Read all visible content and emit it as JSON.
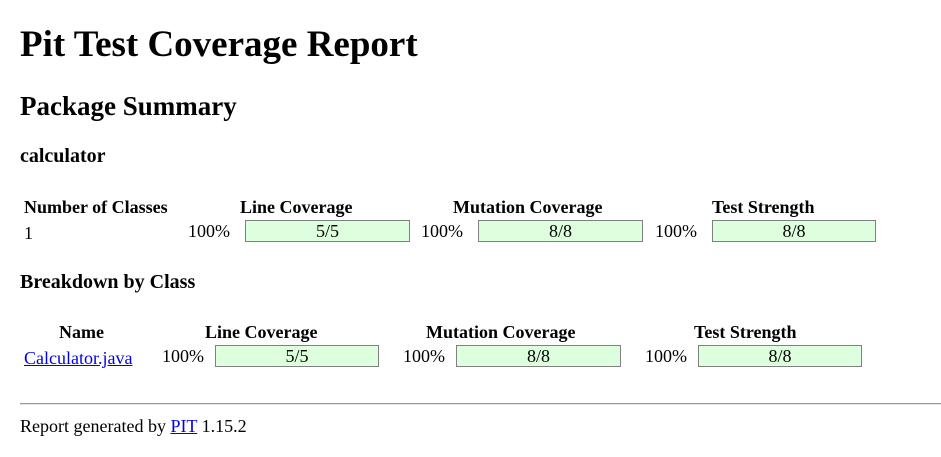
{
  "page": {
    "title": "Pit Test Coverage Report",
    "subtitle": "Package Summary",
    "package_name": "calculator"
  },
  "summary": {
    "headers": {
      "classes": "Number of Classes",
      "line": "Line Coverage",
      "mutation": "Mutation Coverage",
      "strength": "Test Strength"
    },
    "classes": "1",
    "line": {
      "percent": "100%",
      "ratio": "5/5"
    },
    "mutation": {
      "percent": "100%",
      "ratio": "8/8"
    },
    "strength": {
      "percent": "100%",
      "ratio": "8/8"
    }
  },
  "breakdown": {
    "heading": "Breakdown by Class",
    "headers": {
      "name": "Name",
      "line": "Line Coverage",
      "mutation": "Mutation Coverage",
      "strength": "Test Strength"
    },
    "rows": [
      {
        "name": "Calculator.java",
        "line": {
          "percent": "100%",
          "ratio": "5/5"
        },
        "mutation": {
          "percent": "100%",
          "ratio": "8/8"
        },
        "strength": {
          "percent": "100%",
          "ratio": "8/8"
        }
      }
    ]
  },
  "footer": {
    "prefix": "Report generated by",
    "tool": "PIT",
    "version": "1.15.2"
  },
  "colors": {
    "bar_fill": "#ddffdd",
    "bar_border": "#808080",
    "link": "#0000ee"
  }
}
